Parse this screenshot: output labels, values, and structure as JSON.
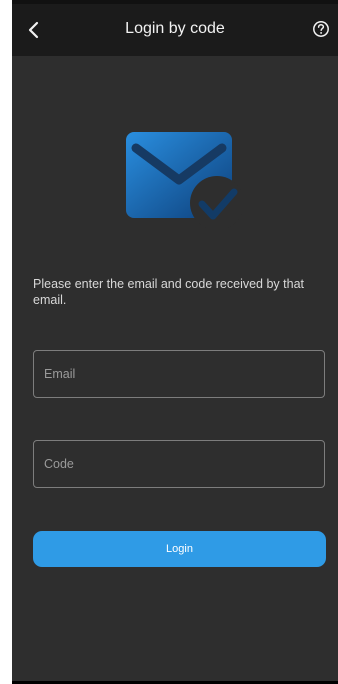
{
  "header": {
    "title": "Login by code",
    "back_icon": "chevron-left-icon",
    "help_icon": "question-circle-icon"
  },
  "illustration": {
    "icon": "email-check-icon",
    "colors": {
      "envelope_light": "#2a8fe0",
      "envelope_dark": "#0d3f7a",
      "check": "#123b66"
    }
  },
  "instructions": "Please enter the email and code received by that email.",
  "form": {
    "email": {
      "placeholder": "Email",
      "value": ""
    },
    "code": {
      "placeholder": "Code",
      "value": ""
    },
    "login_label": "Login"
  },
  "theme": {
    "background": "#2e2e2e",
    "header": "#1b1b1b",
    "accent": "#2f9be6"
  }
}
